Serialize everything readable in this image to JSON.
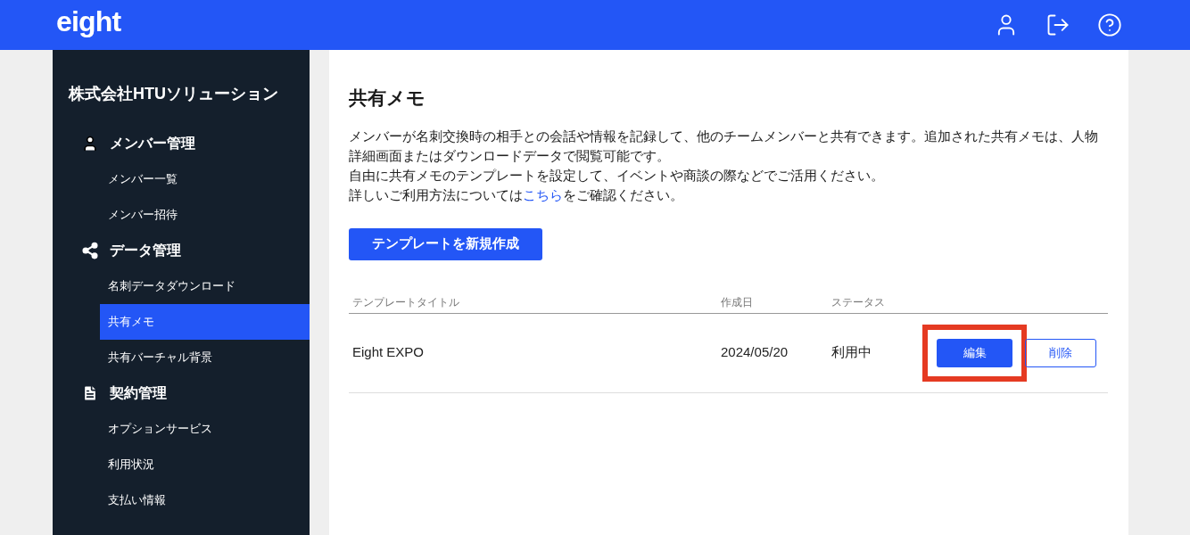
{
  "header": {
    "logo": "eight"
  },
  "sidebar": {
    "company": "株式会社HTUソリューション",
    "sections": [
      {
        "kind": "person",
        "label": "メンバー管理",
        "items": [
          {
            "label": "メンバー一覧",
            "selected": false
          },
          {
            "label": "メンバー招待",
            "selected": false
          }
        ]
      },
      {
        "kind": "share",
        "label": "データ管理",
        "items": [
          {
            "label": "名刺データダウンロード",
            "selected": false
          },
          {
            "label": "共有メモ",
            "selected": true
          },
          {
            "label": "共有バーチャル背景",
            "selected": false
          }
        ]
      },
      {
        "kind": "document",
        "label": "契約管理",
        "items": [
          {
            "label": "オプションサービス",
            "selected": false
          },
          {
            "label": "利用状況",
            "selected": false
          },
          {
            "label": "支払い情報",
            "selected": false
          }
        ]
      }
    ]
  },
  "main": {
    "title": "共有メモ",
    "description": [
      "メンバーが名刺交換時の相手との会話や情報を記録して、他のチームメンバーと共有できます。追加された共有メモは、人物詳細画面またはダウンロードデータで閲覧可能です。",
      "自由に共有メモのテンプレートを設定して、イベントや商談の際などでご活用ください。"
    ],
    "help": {
      "prefix": "詳しいご利用方法については",
      "link": "こちら",
      "suffix": "をご確認ください。"
    },
    "create_button": "テンプレートを新規作成",
    "table": {
      "columns": [
        "テンプレートタイトル",
        "作成日",
        "ステータス"
      ],
      "rows": [
        {
          "title": "Eight EXPO",
          "created": "2024/05/20",
          "status": "利用中",
          "edit": "編集",
          "delete": "削除",
          "highlighted": true
        }
      ]
    }
  }
}
